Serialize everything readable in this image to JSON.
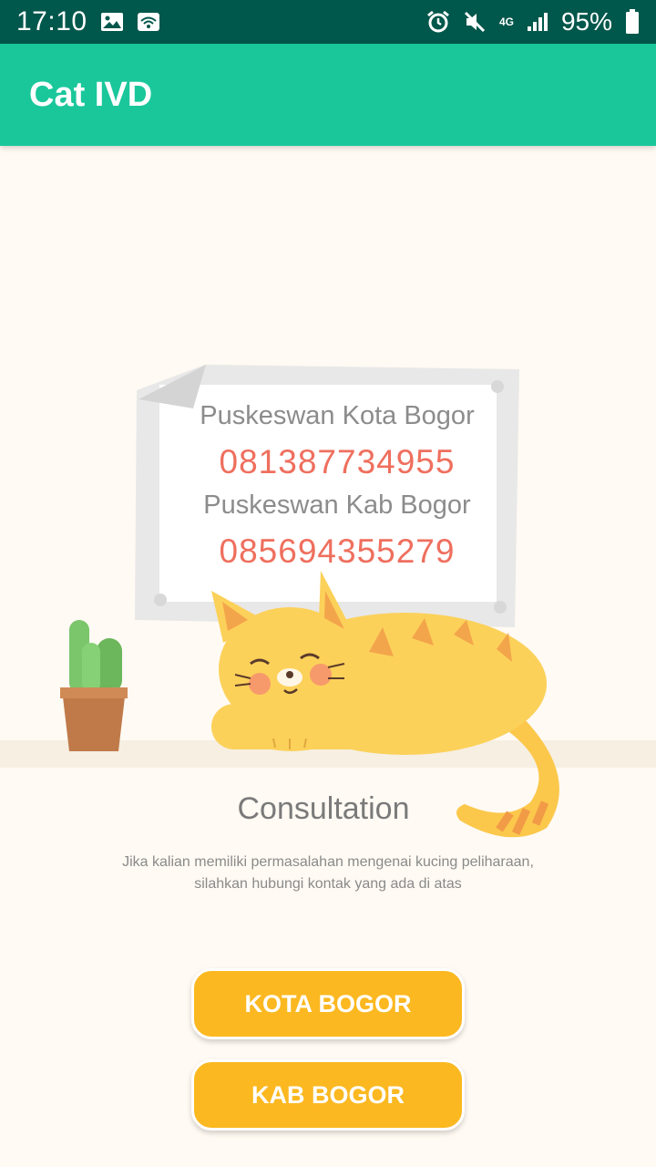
{
  "status_bar": {
    "time": "17:10",
    "network": "4G",
    "battery": "95%",
    "icons": [
      "image-icon",
      "wifi-hotspot-icon",
      "alarm-icon",
      "mute-icon",
      "network-4g-icon",
      "signal-icon",
      "battery-icon"
    ]
  },
  "app_bar": {
    "title": "Cat IVD",
    "color": "#1ac79b"
  },
  "poster": {
    "contacts": [
      {
        "name": "Puskeswan Kota Bogor",
        "phone": "081387734955"
      },
      {
        "name": "Puskeswan Kab Bogor",
        "phone": "085694355279"
      }
    ]
  },
  "consultation": {
    "heading": "Consultation",
    "description_line1": "Jika kalian memiliki permasalahan mengenai kucing peliharaan,",
    "description_line2": "silahkan hubungi kontak yang ada di atas"
  },
  "buttons": {
    "kota": "KOTA BOGOR",
    "kab": "KAB BOGOR",
    "color": "#fbb820"
  }
}
